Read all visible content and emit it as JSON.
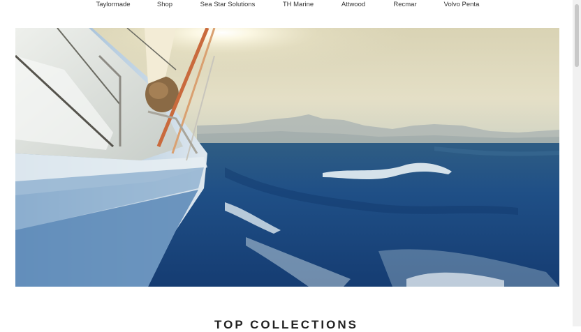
{
  "nav": {
    "items": [
      {
        "label": "Taylormade"
      },
      {
        "label": "Shop"
      },
      {
        "label": "Sea Star Solutions"
      },
      {
        "label": "TH Marine"
      },
      {
        "label": "Attwood"
      },
      {
        "label": "Recmar"
      },
      {
        "label": "Volvo Penta"
      }
    ]
  },
  "hero": {
    "image": "sailboat-on-ocean-sunset-photo"
  },
  "section": {
    "title": "TOP COLLECTIONS"
  }
}
